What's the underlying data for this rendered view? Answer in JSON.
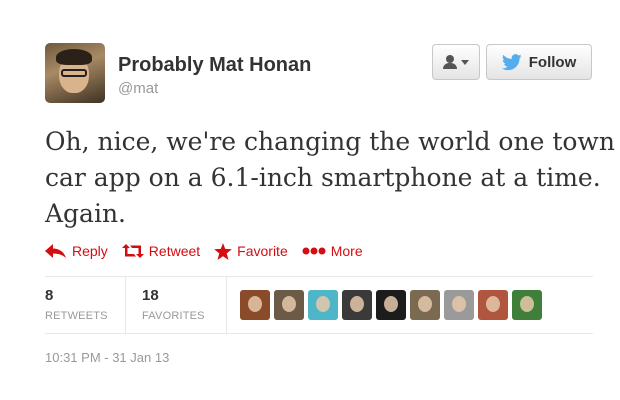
{
  "author": {
    "display_name": "Probably Mat Honan",
    "screen_name": "@mat"
  },
  "header_buttons": {
    "user_menu_icon": "user-icon",
    "follow_label": "Follow",
    "follow_icon": "twitter-bird-icon",
    "follow_icon_color": "#55acee"
  },
  "tweet": {
    "text_lines": [
      "Oh, nice, we're changing the world one town",
      "car app on a 6.1-inch smartphone at a time.",
      "Again."
    ]
  },
  "actions": {
    "accent_color": "#d40d12",
    "items": [
      {
        "label": "Reply",
        "icon": "reply-arrow-icon"
      },
      {
        "label": "Retweet",
        "icon": "retweet-icon"
      },
      {
        "label": "Favorite",
        "icon": "star-icon"
      },
      {
        "label": "More",
        "icon": "more-dots-icon"
      }
    ]
  },
  "stats": {
    "retweets": {
      "count": "8",
      "label": "RETWEETS"
    },
    "favorites": {
      "count": "18",
      "label": "FAVORITES"
    }
  },
  "favoriters": {
    "count_shown": 9,
    "avatar_colors": [
      "#8a4b2a",
      "#6b5a45",
      "#4fb6c9",
      "#3a3a3a",
      "#1c1c1c",
      "#7a6a52",
      "#9a9a9a",
      "#b0563f",
      "#3f7f3a"
    ]
  },
  "timestamp": "10:31 PM - 31 Jan 13"
}
